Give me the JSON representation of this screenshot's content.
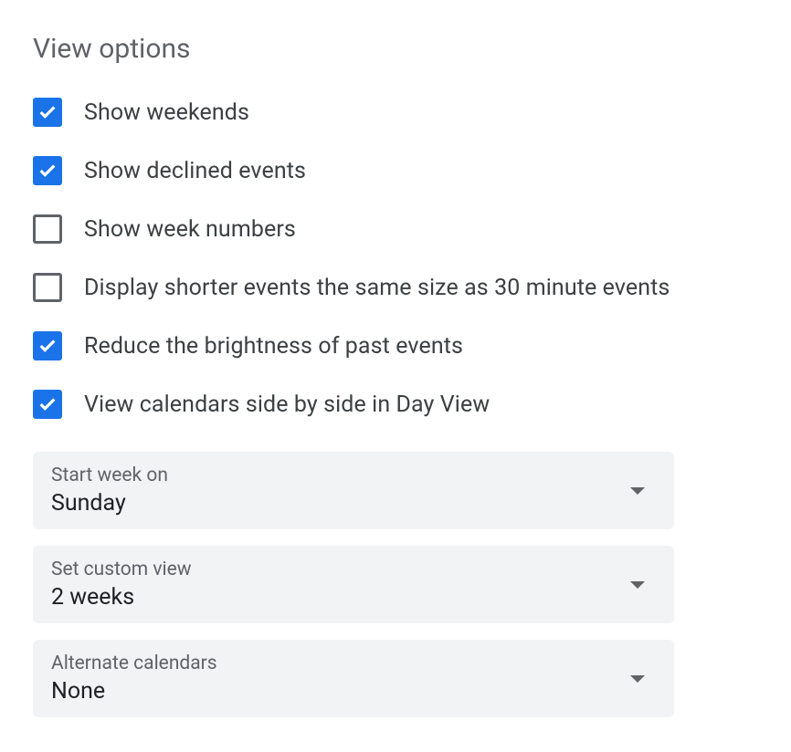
{
  "section_title": "View options",
  "checkboxes": [
    {
      "label": "Show weekends",
      "checked": true
    },
    {
      "label": "Show declined events",
      "checked": true
    },
    {
      "label": "Show week numbers",
      "checked": false
    },
    {
      "label": "Display shorter events the same size as 30 minute events",
      "checked": false
    },
    {
      "label": "Reduce the brightness of past events",
      "checked": true
    },
    {
      "label": "View calendars side by side in Day View",
      "checked": true
    }
  ],
  "dropdowns": [
    {
      "label": "Start week on",
      "value": "Sunday"
    },
    {
      "label": "Set custom view",
      "value": "2 weeks"
    },
    {
      "label": "Alternate calendars",
      "value": "None"
    }
  ]
}
